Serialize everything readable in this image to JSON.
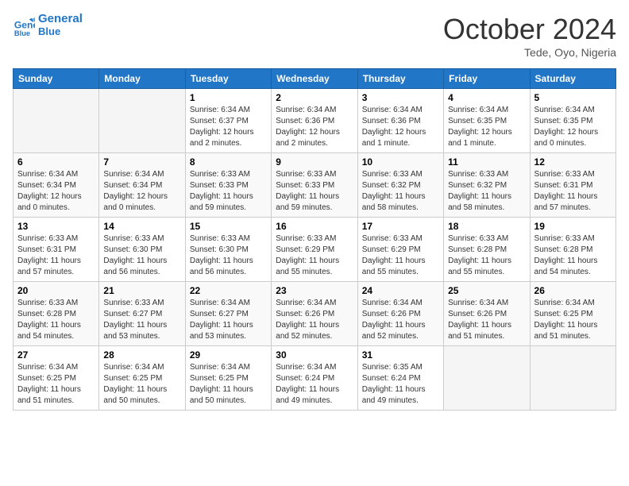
{
  "header": {
    "logo_line1": "General",
    "logo_line2": "Blue",
    "month": "October 2024",
    "location": "Tede, Oyo, Nigeria"
  },
  "weekdays": [
    "Sunday",
    "Monday",
    "Tuesday",
    "Wednesday",
    "Thursday",
    "Friday",
    "Saturday"
  ],
  "weeks": [
    [
      {
        "day": "",
        "info": ""
      },
      {
        "day": "",
        "info": ""
      },
      {
        "day": "1",
        "info": "Sunrise: 6:34 AM\nSunset: 6:37 PM\nDaylight: 12 hours and 2 minutes."
      },
      {
        "day": "2",
        "info": "Sunrise: 6:34 AM\nSunset: 6:36 PM\nDaylight: 12 hours and 2 minutes."
      },
      {
        "day": "3",
        "info": "Sunrise: 6:34 AM\nSunset: 6:36 PM\nDaylight: 12 hours and 1 minute."
      },
      {
        "day": "4",
        "info": "Sunrise: 6:34 AM\nSunset: 6:35 PM\nDaylight: 12 hours and 1 minute."
      },
      {
        "day": "5",
        "info": "Sunrise: 6:34 AM\nSunset: 6:35 PM\nDaylight: 12 hours and 0 minutes."
      }
    ],
    [
      {
        "day": "6",
        "info": "Sunrise: 6:34 AM\nSunset: 6:34 PM\nDaylight: 12 hours and 0 minutes."
      },
      {
        "day": "7",
        "info": "Sunrise: 6:34 AM\nSunset: 6:34 PM\nDaylight: 12 hours and 0 minutes."
      },
      {
        "day": "8",
        "info": "Sunrise: 6:33 AM\nSunset: 6:33 PM\nDaylight: 11 hours and 59 minutes."
      },
      {
        "day": "9",
        "info": "Sunrise: 6:33 AM\nSunset: 6:33 PM\nDaylight: 11 hours and 59 minutes."
      },
      {
        "day": "10",
        "info": "Sunrise: 6:33 AM\nSunset: 6:32 PM\nDaylight: 11 hours and 58 minutes."
      },
      {
        "day": "11",
        "info": "Sunrise: 6:33 AM\nSunset: 6:32 PM\nDaylight: 11 hours and 58 minutes."
      },
      {
        "day": "12",
        "info": "Sunrise: 6:33 AM\nSunset: 6:31 PM\nDaylight: 11 hours and 57 minutes."
      }
    ],
    [
      {
        "day": "13",
        "info": "Sunrise: 6:33 AM\nSunset: 6:31 PM\nDaylight: 11 hours and 57 minutes."
      },
      {
        "day": "14",
        "info": "Sunrise: 6:33 AM\nSunset: 6:30 PM\nDaylight: 11 hours and 56 minutes."
      },
      {
        "day": "15",
        "info": "Sunrise: 6:33 AM\nSunset: 6:30 PM\nDaylight: 11 hours and 56 minutes."
      },
      {
        "day": "16",
        "info": "Sunrise: 6:33 AM\nSunset: 6:29 PM\nDaylight: 11 hours and 55 minutes."
      },
      {
        "day": "17",
        "info": "Sunrise: 6:33 AM\nSunset: 6:29 PM\nDaylight: 11 hours and 55 minutes."
      },
      {
        "day": "18",
        "info": "Sunrise: 6:33 AM\nSunset: 6:28 PM\nDaylight: 11 hours and 55 minutes."
      },
      {
        "day": "19",
        "info": "Sunrise: 6:33 AM\nSunset: 6:28 PM\nDaylight: 11 hours and 54 minutes."
      }
    ],
    [
      {
        "day": "20",
        "info": "Sunrise: 6:33 AM\nSunset: 6:28 PM\nDaylight: 11 hours and 54 minutes."
      },
      {
        "day": "21",
        "info": "Sunrise: 6:33 AM\nSunset: 6:27 PM\nDaylight: 11 hours and 53 minutes."
      },
      {
        "day": "22",
        "info": "Sunrise: 6:34 AM\nSunset: 6:27 PM\nDaylight: 11 hours and 53 minutes."
      },
      {
        "day": "23",
        "info": "Sunrise: 6:34 AM\nSunset: 6:26 PM\nDaylight: 11 hours and 52 minutes."
      },
      {
        "day": "24",
        "info": "Sunrise: 6:34 AM\nSunset: 6:26 PM\nDaylight: 11 hours and 52 minutes."
      },
      {
        "day": "25",
        "info": "Sunrise: 6:34 AM\nSunset: 6:26 PM\nDaylight: 11 hours and 51 minutes."
      },
      {
        "day": "26",
        "info": "Sunrise: 6:34 AM\nSunset: 6:25 PM\nDaylight: 11 hours and 51 minutes."
      }
    ],
    [
      {
        "day": "27",
        "info": "Sunrise: 6:34 AM\nSunset: 6:25 PM\nDaylight: 11 hours and 51 minutes."
      },
      {
        "day": "28",
        "info": "Sunrise: 6:34 AM\nSunset: 6:25 PM\nDaylight: 11 hours and 50 minutes."
      },
      {
        "day": "29",
        "info": "Sunrise: 6:34 AM\nSunset: 6:25 PM\nDaylight: 11 hours and 50 minutes."
      },
      {
        "day": "30",
        "info": "Sunrise: 6:34 AM\nSunset: 6:24 PM\nDaylight: 11 hours and 49 minutes."
      },
      {
        "day": "31",
        "info": "Sunrise: 6:35 AM\nSunset: 6:24 PM\nDaylight: 11 hours and 49 minutes."
      },
      {
        "day": "",
        "info": ""
      },
      {
        "day": "",
        "info": ""
      }
    ]
  ]
}
